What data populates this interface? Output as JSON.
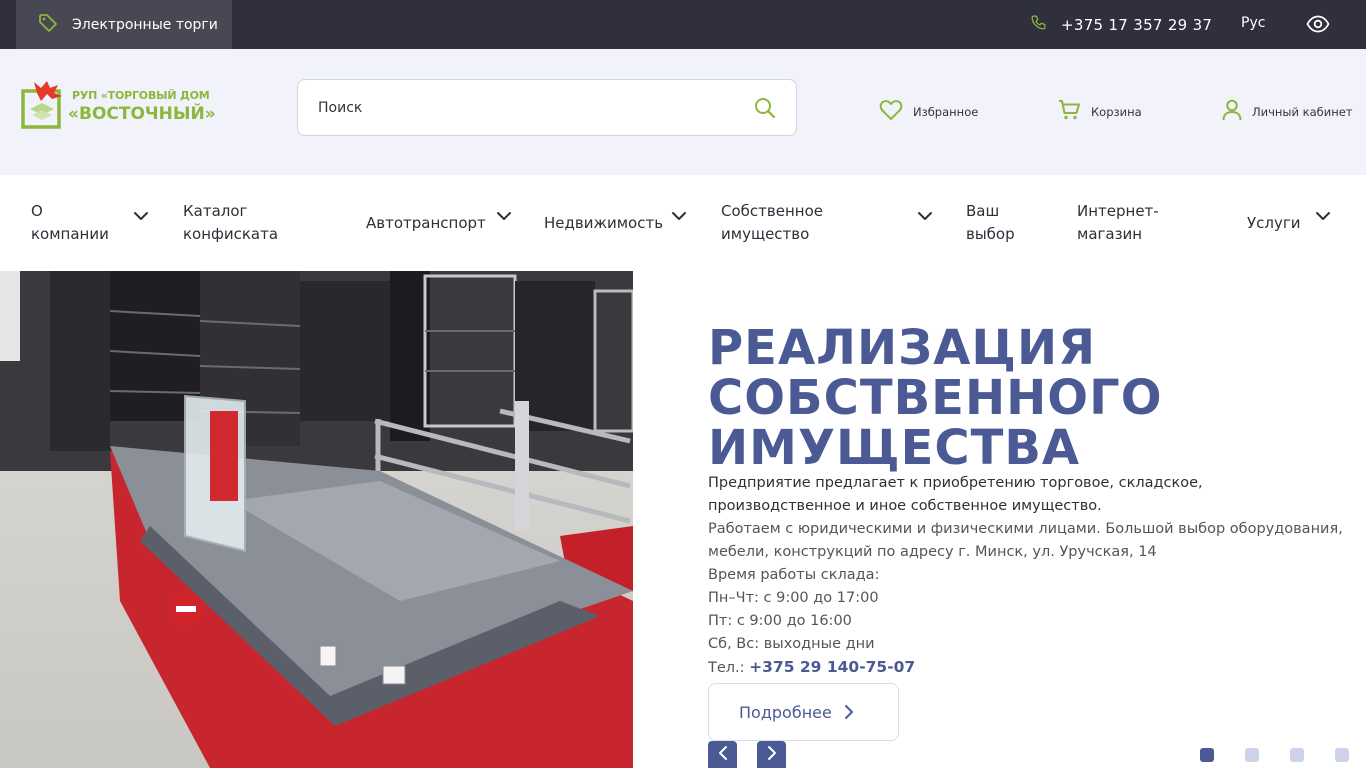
{
  "topbar": {
    "eauction_label": "Электронные торги",
    "phone": "+375 17 357 29 37",
    "language": "Рус"
  },
  "header": {
    "logo": {
      "line1": "РУП «ТОРГОВЫЙ ДОМ",
      "line2": "«ВОСТОЧНЫЙ»"
    },
    "search_placeholder": "Поиск",
    "links": {
      "favorites": "Избранное",
      "cart": "Корзина",
      "account": "Личный кабинет"
    }
  },
  "nav": {
    "items": [
      {
        "label": "О компании"
      },
      {
        "label": "Каталог конфиската"
      },
      {
        "label": "Автотранспорт"
      },
      {
        "label": "Недвижимость"
      },
      {
        "label": "Собственное имущество"
      },
      {
        "label": "Ваш выбор"
      },
      {
        "label": "Интернет-магазин"
      },
      {
        "label": "Услуги"
      }
    ]
  },
  "hero": {
    "title": "РЕАЛИЗАЦИЯ СОБСТВЕННОГО ИМУЩЕСТВА",
    "p1": "Предприятие предлагает к приобретению торговое, складское, производственное и иное собственное имущество.",
    "p2": "Работаем с юридическими и физическими лицами. Большой выбор оборудования, мебели, конструкций по адресу г. Минск, ул. Уручская, 14",
    "hours_title": "Время работы склада:",
    "hours_1": "Пн–Чт: с 9:00 до 17:00",
    "hours_2": "Пт: с 9:00 до 16:00",
    "hours_3": "Сб, Вс: выходные дни",
    "tel_label": "Тел.:",
    "tel_number": "+375 29 140-75-07",
    "more_label": "Подробнее"
  },
  "slider": {
    "slide_count": 4,
    "active_slide": 1
  },
  "colors": {
    "accent": "#4b5a94",
    "brand_green": "#8bb73b",
    "topbar": "#2f2f3d",
    "header_bg": "#f2f3fa"
  }
}
